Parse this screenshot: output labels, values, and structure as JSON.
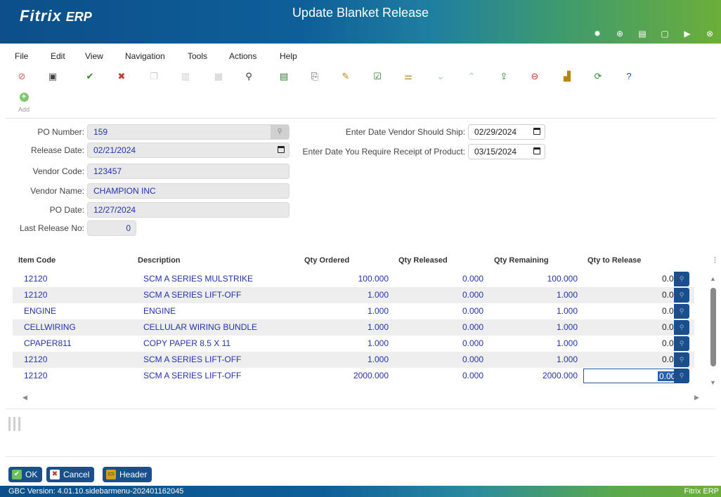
{
  "titlebar": {
    "logo": "Fitrix",
    "logo_erp": "ERP",
    "title": "Update Blanket Release",
    "buttons": [
      "gear-icon",
      "globe-icon",
      "document-icon",
      "new-document-icon",
      "play-icon",
      "close-icon"
    ]
  },
  "menu": [
    "File",
    "Edit",
    "View",
    "Navigation",
    "Tools",
    "Actions",
    "Help"
  ],
  "toolbar": {
    "add_label": "Add"
  },
  "form": {
    "po_number_label": "PO Number:",
    "po_number": "159",
    "release_date_label": "Release Date:",
    "release_date": "02/21/2024",
    "vendor_code_label": "Vendor Code:",
    "vendor_code": "123457",
    "vendor_name_label": "Vendor Name:",
    "vendor_name": "CHAMPION INC",
    "po_date_label": "PO Date:",
    "po_date": "12/27/2024",
    "last_release_label": "Last Release No:",
    "last_release": "0",
    "ship_date_label": "Enter Date Vendor Should Ship:",
    "ship_date": "02/29/2024",
    "receipt_date_label": "Enter Date You Require Receipt of Product:",
    "receipt_date": "03/15/2024"
  },
  "table": {
    "columns": [
      "Item Code",
      "Description",
      "Qty Ordered",
      "Qty Released",
      "Qty Remaining",
      "Qty to Release"
    ],
    "rows": [
      {
        "code": "12120",
        "desc": "SCM A SERIES MULSTRIKE",
        "ordered": "100.000",
        "released": "0.000",
        "remaining": "100.000",
        "to_release": "0.000"
      },
      {
        "code": "12120",
        "desc": "SCM A SERIES LIFT-OFF",
        "ordered": "1.000",
        "released": "0.000",
        "remaining": "1.000",
        "to_release": "0.000"
      },
      {
        "code": "ENGINE",
        "desc": "ENGINE",
        "ordered": "1.000",
        "released": "0.000",
        "remaining": "1.000",
        "to_release": "0.000"
      },
      {
        "code": "CELLWIRING",
        "desc": "CELLULAR WIRING BUNDLE",
        "ordered": "1.000",
        "released": "0.000",
        "remaining": "1.000",
        "to_release": "0.000"
      },
      {
        "code": "CPAPER811",
        "desc": "COPY PAPER 8.5 X 11",
        "ordered": "1.000",
        "released": "0.000",
        "remaining": "1.000",
        "to_release": "0.000"
      },
      {
        "code": "12120",
        "desc": "SCM A SERIES LIFT-OFF",
        "ordered": "1.000",
        "released": "0.000",
        "remaining": "1.000",
        "to_release": "0.000"
      },
      {
        "code": "12120",
        "desc": "SCM A SERIES LIFT-OFF",
        "ordered": "2000.000",
        "released": "0.000",
        "remaining": "2000.000",
        "to_release": "0.000"
      }
    ]
  },
  "buttons": {
    "ok": "OK",
    "cancel": "Cancel",
    "header": "Header"
  },
  "status": {
    "version": "GBC Version: 4.01.10.sidebarmenu-202401162045",
    "brand": "Fitrix ERP"
  },
  "colors": {
    "title_gradient_start": "#0c4f8a",
    "title_gradient_end": "#6cae3a",
    "value_text": "#2233aa",
    "button_blue": "#1a4f8e"
  }
}
